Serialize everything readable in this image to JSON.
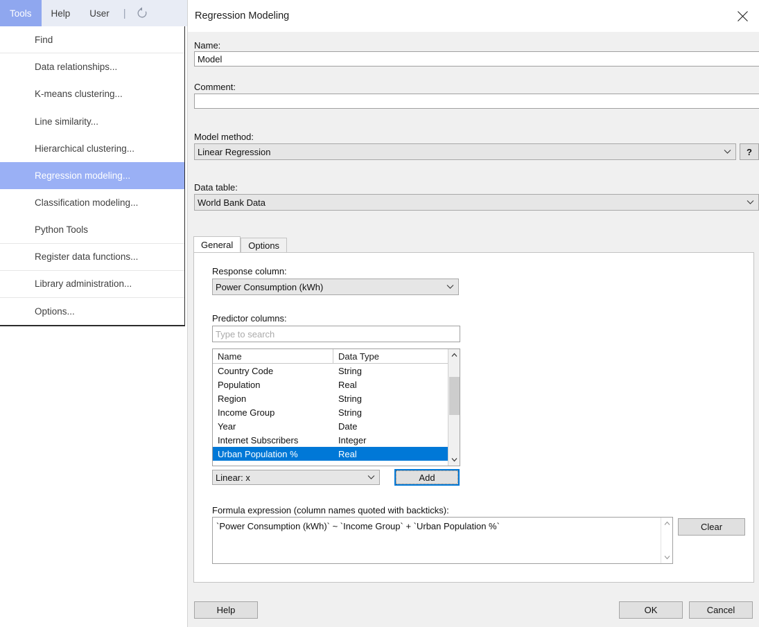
{
  "menubar": {
    "items": [
      {
        "label": "Tools",
        "active": true
      },
      {
        "label": "Help",
        "active": false
      },
      {
        "label": "User",
        "active": false
      }
    ],
    "separator": "|",
    "refresh_icon": "refresh-icon"
  },
  "menu": {
    "entries": [
      {
        "label": "Find",
        "selected": false,
        "sep_after": true
      },
      {
        "label": "Data relationships...",
        "selected": false,
        "sep_after": false
      },
      {
        "label": "K-means clustering...",
        "selected": false,
        "sep_after": false
      },
      {
        "label": "Line similarity...",
        "selected": false,
        "sep_after": false
      },
      {
        "label": "Hierarchical clustering...",
        "selected": false,
        "sep_after": false
      },
      {
        "label": "Regression modeling...",
        "selected": true,
        "sep_after": false
      },
      {
        "label": "Classification modeling...",
        "selected": false,
        "sep_after": false
      },
      {
        "label": "Python Tools",
        "selected": false,
        "sep_after": true
      },
      {
        "label": "Register data functions...",
        "selected": false,
        "sep_after": true
      },
      {
        "label": "Library administration...",
        "selected": false,
        "sep_after": true
      },
      {
        "label": "Options...",
        "selected": false,
        "sep_after": false
      }
    ]
  },
  "dialog": {
    "title": "Regression Modeling",
    "close_icon": "close-icon",
    "name_label": "Name:",
    "name_value": "Model",
    "comment_label": "Comment:",
    "comment_value": "",
    "model_method_label": "Model method:",
    "model_method_value": "Linear Regression",
    "help_button": "?",
    "data_table_label": "Data table:",
    "data_table_value": "World Bank Data",
    "tabs": [
      {
        "label": "General",
        "active": true
      },
      {
        "label": "Options",
        "active": false
      }
    ],
    "response_label": "Response column:",
    "response_value": "Power Consumption (kWh)",
    "predictor_label": "Predictor columns:",
    "search_placeholder": "Type to search",
    "search_value": "",
    "list_headers": [
      "Name",
      "Data Type"
    ],
    "list_rows": [
      {
        "name": "Country Code",
        "type": "String",
        "selected": false
      },
      {
        "name": "Population",
        "type": "Real",
        "selected": false
      },
      {
        "name": "Region",
        "type": "String",
        "selected": false
      },
      {
        "name": "Income Group",
        "type": "String",
        "selected": false
      },
      {
        "name": "Year",
        "type": "Date",
        "selected": false
      },
      {
        "name": "Internet Subscribers",
        "type": "Integer",
        "selected": false
      },
      {
        "name": "Urban Population %",
        "type": "Real",
        "selected": true
      }
    ],
    "term_type_value": "Linear: x",
    "add_button": "Add",
    "formula_label": "Formula expression (column names quoted with backticks):",
    "formula_value": "`Power Consumption (kWh)` ~ `Income Group` + `Urban Population %`",
    "clear_button": "Clear",
    "help_footer_button": "Help",
    "ok_button": "OK",
    "cancel_button": "Cancel"
  },
  "colors": {
    "menu_accent": "#8fa7ef",
    "menu_selected": "#9ab0f5",
    "list_selection": "#0078d7",
    "focus_border": "#0078d7",
    "dialog_bg": "#f0f0f0"
  }
}
